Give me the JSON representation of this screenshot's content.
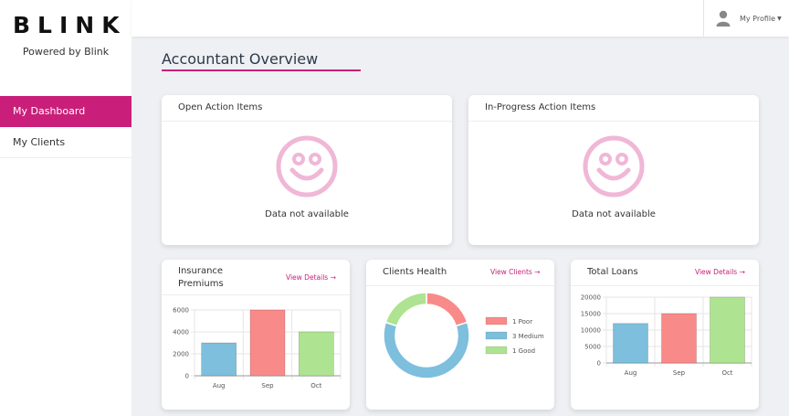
{
  "brand": {
    "logo_text": "BLINK",
    "tagline": "Powered by Blink"
  },
  "sidebar": {
    "items": [
      {
        "label": "My Dashboard",
        "active": true
      },
      {
        "label": "My Clients",
        "active": false
      }
    ]
  },
  "topbar": {
    "profile_label": "My Profile",
    "profile_icon": "user-icon"
  },
  "page": {
    "title": "Accountant Overview"
  },
  "colors": {
    "accent": "#c91f7a",
    "blue": "#7dbfdc",
    "red": "#f98a8a",
    "green": "#aee391",
    "face": "#f0b7d6"
  },
  "cards": {
    "open_items": {
      "title": "Open Action Items",
      "empty_text": "Data not available",
      "icon": "smiley-face-icon"
    },
    "in_progress": {
      "title": "In-Progress Action Items",
      "empty_text": "Data not available",
      "icon": "smiley-face-icon"
    },
    "insurance": {
      "title_line1": "Insurance",
      "title_line2": "Premiums",
      "link": "View Details →"
    },
    "health": {
      "title": "Clients Health",
      "link": "View Clients →"
    },
    "loans": {
      "title": "Total Loans",
      "link": "View Details →"
    }
  },
  "chart_data": [
    {
      "type": "bar",
      "title": "Insurance Premiums",
      "categories": [
        "Aug",
        "Sep",
        "Oct"
      ],
      "values": [
        3000,
        6000,
        4000
      ],
      "colors": [
        "#7dbfdc",
        "#f98a8a",
        "#aee391"
      ],
      "ylim": [
        0,
        6000
      ],
      "yticks": [
        "6000",
        "4000",
        "2000",
        "0"
      ],
      "grid": true
    },
    {
      "type": "pie",
      "title": "Clients Health",
      "labels": [
        "1 Poor",
        "3 Medium",
        "1 Good"
      ],
      "values": [
        1,
        3,
        1
      ],
      "colors": [
        "#f98a8a",
        "#7dbfdc",
        "#aee391"
      ],
      "legend": "right"
    },
    {
      "type": "bar",
      "title": "Total Loans",
      "categories": [
        "Aug",
        "Sep",
        "Oct"
      ],
      "values": [
        12000,
        15000,
        20000
      ],
      "colors": [
        "#7dbfdc",
        "#f98a8a",
        "#aee391"
      ],
      "ylim": [
        0,
        20000
      ],
      "yticks": [
        "20000",
        "15000",
        "10000",
        "5000",
        "0"
      ],
      "grid": true
    }
  ]
}
